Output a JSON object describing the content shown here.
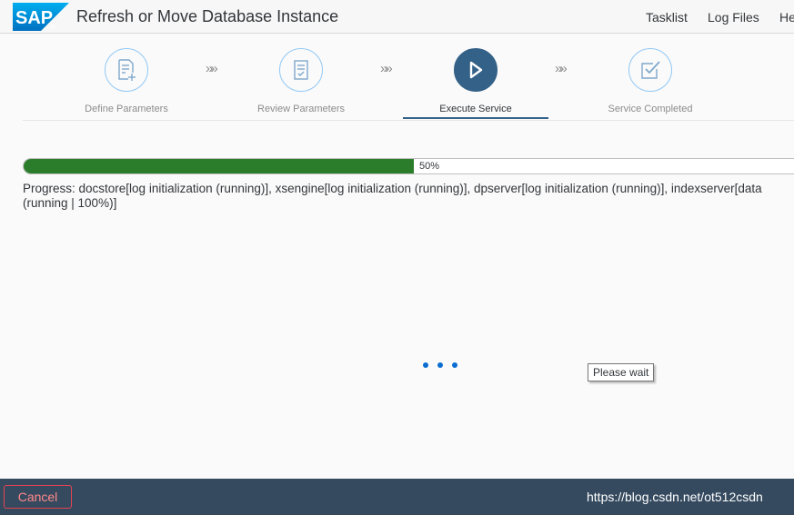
{
  "header": {
    "logo_text": "SAP",
    "title": "Refresh or Move Database Instance",
    "nav": [
      "Tasklist",
      "Log Files",
      "He"
    ]
  },
  "wizard": {
    "steps": [
      {
        "label": "Define Parameters",
        "icon": "document-add-icon",
        "state": "done"
      },
      {
        "label": "Review Parameters",
        "icon": "document-review-icon",
        "state": "done"
      },
      {
        "label": "Execute Service",
        "icon": "play-icon",
        "state": "active"
      },
      {
        "label": "Service Completed",
        "icon": "checkbox-check-icon",
        "state": "pending"
      }
    ],
    "separator": "»»"
  },
  "progress": {
    "value": 50,
    "label": "50%",
    "message": "Progress: docstore[log initialization (running)], xsengine[log initialization (running)], dpserver[log initialization (running)], indexserver[data (running | 100%)]"
  },
  "busy": {
    "tooltip": "Please wait"
  },
  "footer": {
    "cancel_label": "Cancel",
    "watermark": "https://blog.csdn.net/ot512csdn"
  },
  "colors": {
    "brand_blue": "#0a6ed1",
    "active_step": "#346187",
    "progress_fill": "#2b7d2b",
    "footer_bg": "#354a5f",
    "cancel_red": "#e34352"
  }
}
